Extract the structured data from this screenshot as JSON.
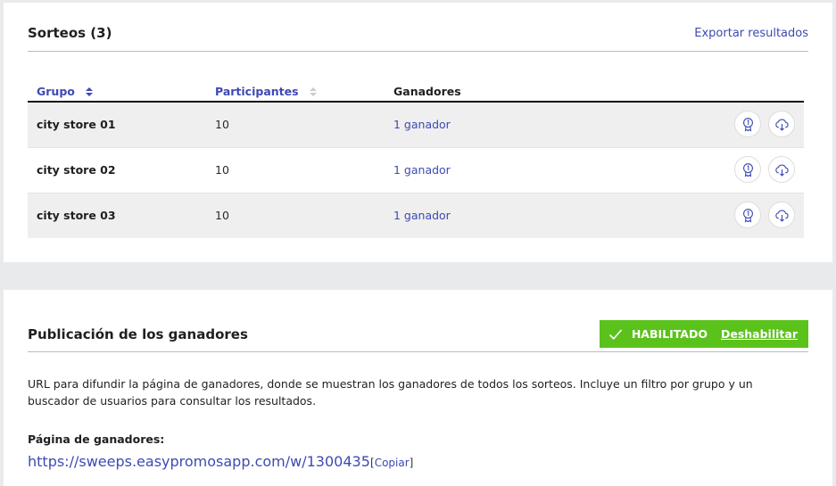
{
  "draws": {
    "title": "Sorteos (3)",
    "export_label": "Exportar resultados",
    "columns": {
      "group": "Grupo",
      "participants": "Participantes",
      "winners": "Ganadores"
    },
    "rows": [
      {
        "group": "city store 01",
        "participants": "10",
        "winners": "1 ganador"
      },
      {
        "group": "city store 02",
        "participants": "10",
        "winners": "1 ganador"
      },
      {
        "group": "city store 03",
        "participants": "10",
        "winners": "1 ganador"
      }
    ],
    "row_icons": [
      "award-icon",
      "cloud-download-icon"
    ]
  },
  "publication": {
    "title": "Publicación de los ganadores",
    "status": "HABILITADO",
    "disable_label": "Deshabilitar",
    "description": "URL para difundir la página de ganadores, donde se muestran los ganadores de todos los sorteos. Incluye un filtro por grupo y un buscador de usuarios para consultar los resultados.",
    "page_label": "Página de ganadores:",
    "url": "https://sweeps.easypromosapp.com/w/1300435",
    "copy_open": "[",
    "copy_label": "Copiar",
    "copy_close": "]"
  },
  "colors": {
    "accent": "#3d4ab3",
    "enabled_badge": "#5bc21c",
    "row_shade": "#efefef",
    "gap": "#e9eaeb"
  }
}
